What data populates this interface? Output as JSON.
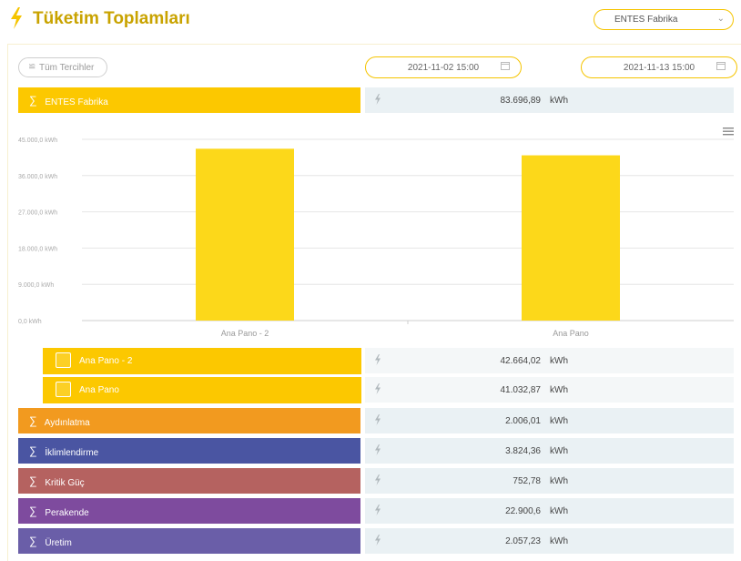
{
  "header": {
    "title": "Tüketim Toplamları",
    "factory_select": "ENTES Fabrika"
  },
  "toolbar": {
    "preferences_label": "Tüm Tercihler",
    "date_start": "2021-11-02 15:00",
    "date_end": "2021-11-13 15:00"
  },
  "summary": {
    "label": "ENTES Fabrika",
    "value": "83.696,89",
    "unit": "kWh",
    "color": "#fcc800"
  },
  "chart_data": {
    "type": "bar",
    "categories": [
      "Ana Pano - 2",
      "Ana Pano"
    ],
    "values": [
      42664.02,
      41032.87
    ],
    "ylim": [
      0,
      45000
    ],
    "yticks": [
      "0,0 kWh",
      "9.000,0 kWh",
      "18.000,0 kWh",
      "27.000,0 kWh",
      "36.000,0 kWh",
      "45.000,0 kWh"
    ],
    "ytick_values": [
      0,
      9000,
      18000,
      27000,
      36000,
      45000
    ],
    "grid": true,
    "bar_color": "#fcd81a"
  },
  "sub_items": [
    {
      "label": "Ana Pano - 2",
      "value": "42.664,02",
      "unit": "kWh",
      "icon": "panel-icon"
    },
    {
      "label": "Ana Pano",
      "value": "41.032,87",
      "unit": "kWh",
      "icon": "panel-icon"
    }
  ],
  "groups": [
    {
      "label": "Aydınlatma",
      "value": "2.006,01",
      "unit": "kWh",
      "color": "#f29a1f"
    },
    {
      "label": "İklimlendirme",
      "value": "3.824,36",
      "unit": "kWh",
      "color": "#4a55a2"
    },
    {
      "label": "Kritik Güç",
      "value": "752,78",
      "unit": "kWh",
      "color": "#b56260"
    },
    {
      "label": "Perakende",
      "value": "22.900,6",
      "unit": "kWh",
      "color": "#7e4b9e"
    },
    {
      "label": "Üretim",
      "value": "2.057,23",
      "unit": "kWh",
      "color": "#6a5ea8"
    }
  ],
  "theme": {
    "accent": "#f5c400",
    "title_color": "#c9a300"
  }
}
